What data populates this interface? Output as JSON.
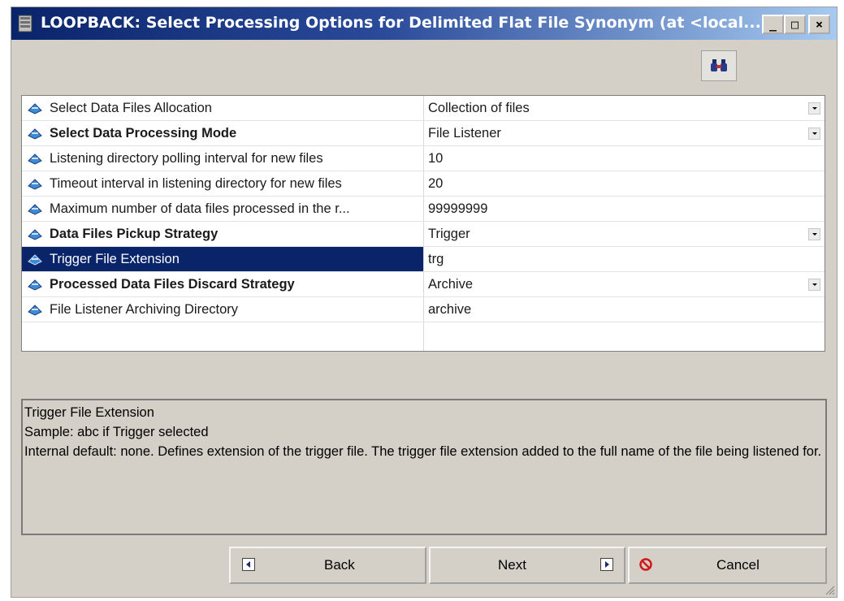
{
  "window": {
    "title": "LOOPBACK: Select Processing Options for Delimited Flat File Synonym (at <local...",
    "controls": {
      "minimize": "_",
      "maximize": "□",
      "close": "×"
    }
  },
  "toolbar": {
    "icon": "binoculars-icon"
  },
  "properties": [
    {
      "name": "Select Data Files Allocation",
      "value": "Collection of files",
      "bold": false,
      "dropdown": true
    },
    {
      "name": "Select Data Processing Mode",
      "value": "File Listener",
      "bold": true,
      "dropdown": true
    },
    {
      "name": "Listening directory polling interval for new files",
      "value": "10",
      "bold": false,
      "dropdown": false
    },
    {
      "name": "Timeout interval in listening directory for new files",
      "value": "20",
      "bold": false,
      "dropdown": false
    },
    {
      "name": "Maximum number of data files processed in the r...",
      "value": "99999999",
      "bold": false,
      "dropdown": false
    },
    {
      "name": "Data Files Pickup Strategy",
      "value": "Trigger",
      "bold": true,
      "dropdown": true
    },
    {
      "name": "Trigger File Extension",
      "value": "trg",
      "bold": false,
      "dropdown": false,
      "selected": true
    },
    {
      "name": "Processed Data Files Discard Strategy",
      "value": "Archive",
      "bold": true,
      "dropdown": true
    },
    {
      "name": "File Listener Archiving Directory",
      "value": "archive",
      "bold": false,
      "dropdown": false
    }
  ],
  "description": {
    "title": "Trigger File Extension",
    "sample": "Sample: abc if Trigger selected",
    "detail": "Internal default: none. Defines extension of the trigger file. The trigger file extension added to the full name of the file being listened for."
  },
  "buttons": {
    "back": "Back",
    "next": "Next",
    "cancel": "Cancel"
  },
  "colors": {
    "selection": "#0a246a",
    "title_gradient_start": "#0a246a",
    "title_gradient_end": "#a6caf0",
    "dialog_bg": "#d4d0c8"
  }
}
